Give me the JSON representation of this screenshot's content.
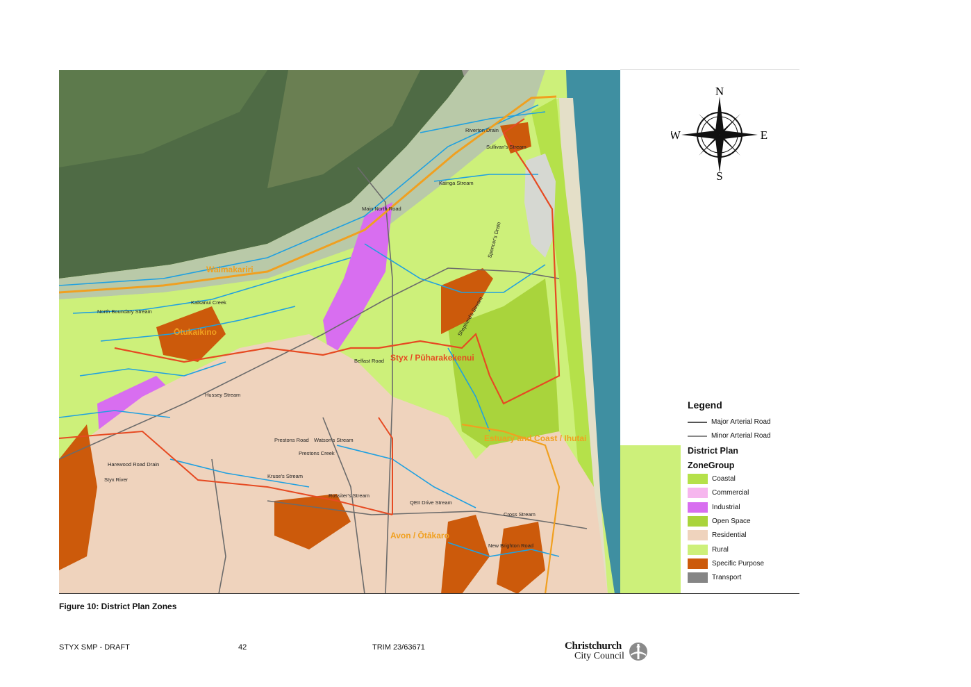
{
  "map": {
    "area_labels": [
      "Waimakariri",
      "Ōtukaikino",
      "Styx / Pūharakekenui",
      "Estuary and Coast / Ihutai",
      "Avon / Ōtākaro"
    ],
    "stream_labels": [
      "Riverton Drain",
      "Sullivan's Stream",
      "Kainga Stream",
      "Main North Road",
      "North Boundary Stream",
      "Kaikanui Creek",
      "Belfast Road",
      "Styx River",
      "Hussey Stream",
      "Harewood Road Drain",
      "Prestons Road",
      "Watson's Stream",
      "Rossiter's Stream",
      "QEII Drive Stream",
      "Cross Stream",
      "New Brighton Road",
      "Spencer's Drain",
      "Shepherd's Stream",
      "Kruse's Stream",
      "Prestons Creek"
    ],
    "colors": {
      "coastal": "#b5e14a",
      "commercial": "#f6b6ee",
      "industrial": "#d86ef0",
      "open_space": "#a9d43c",
      "residential": "#efd3bd",
      "rural": "#cdf07a",
      "specific_purpose": "#cc5a0b",
      "transport": "#858585",
      "catchment_orange": "#f0a020",
      "catchment_red": "#e64a22",
      "stream_blue": "#1fa0e0",
      "sea": "#3f8fa1"
    }
  },
  "compass": {
    "n": "N",
    "s": "S",
    "e": "E",
    "w": "W"
  },
  "legend": {
    "title": "Legend",
    "roads": [
      {
        "label": "Major Arterial Road"
      },
      {
        "label": "Minor Arterial Road"
      }
    ],
    "subtitle1": "District Plan",
    "subtitle2": "ZoneGroup",
    "zones": [
      {
        "label": "Coastal",
        "color": "#b5e14a"
      },
      {
        "label": "Commercial",
        "color": "#f6b6ee"
      },
      {
        "label": "Industrial",
        "color": "#d86ef0"
      },
      {
        "label": "Open Space",
        "color": "#a9d43c"
      },
      {
        "label": "Residential",
        "color": "#efd3bd"
      },
      {
        "label": "Rural",
        "color": "#cdf07a"
      },
      {
        "label": "Specific Purpose",
        "color": "#cc5a0b"
      },
      {
        "label": "Transport",
        "color": "#858585"
      }
    ]
  },
  "caption": "Figure 10: District Plan Zones",
  "footer": {
    "doc": "STYX SMP - DRAFT",
    "page": "42",
    "trim": "TRIM 23/63671",
    "logo_line1": "Christchurch",
    "logo_line2": "City Council"
  }
}
